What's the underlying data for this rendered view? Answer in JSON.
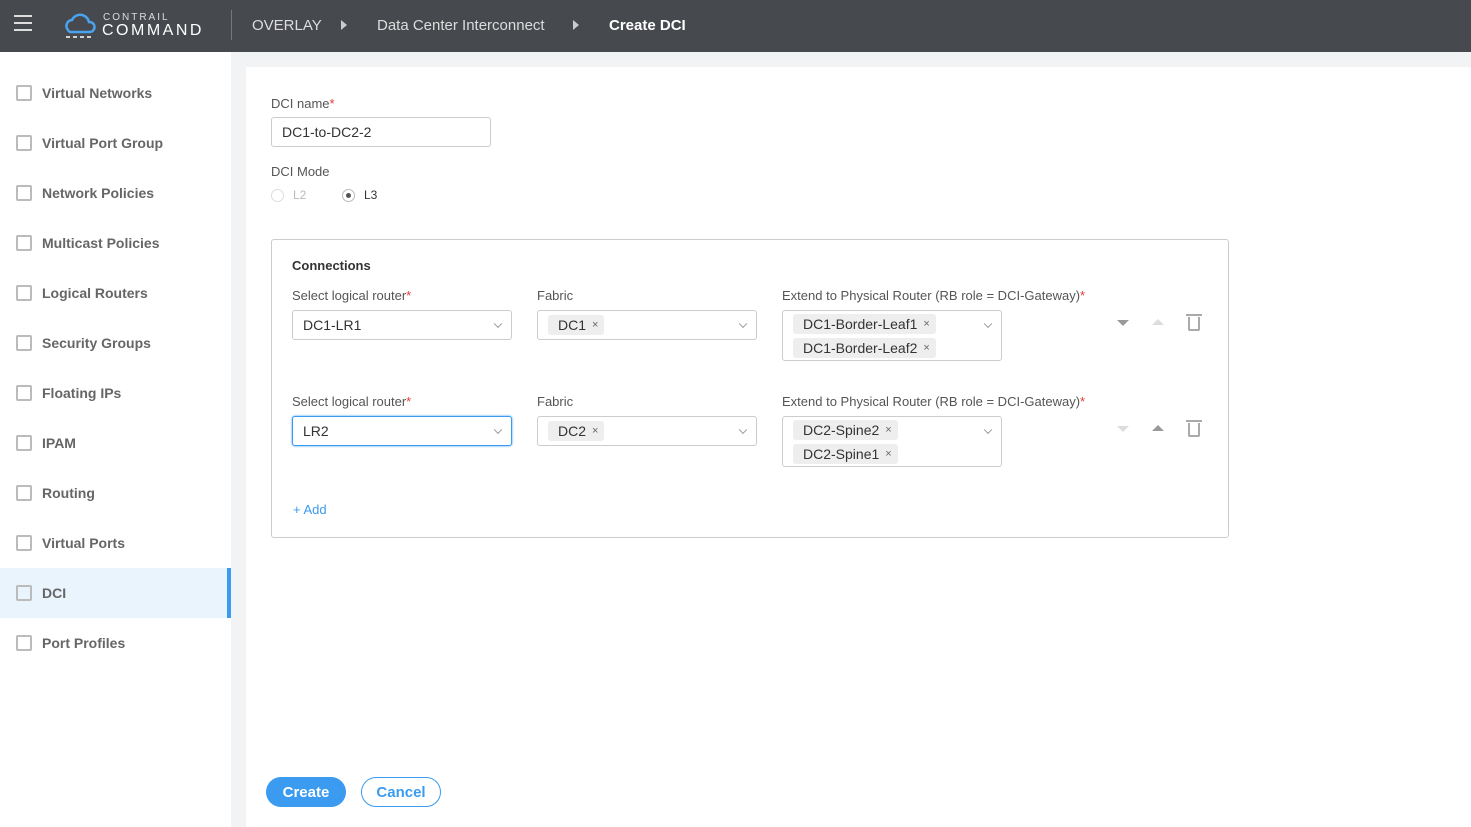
{
  "header": {
    "logo_top": "CONTRAIL",
    "logo_bottom": "COMMAND",
    "breadcrumb": [
      "OVERLAY",
      "Data Center Interconnect",
      "Create DCI"
    ]
  },
  "sidebar": {
    "items": [
      {
        "label": "Virtual Networks",
        "icon": "virtual-networks-icon"
      },
      {
        "label": "Virtual Port Group",
        "icon": "port-group-icon"
      },
      {
        "label": "Network Policies",
        "icon": "policy-icon"
      },
      {
        "label": "Multicast Policies",
        "icon": "multicast-icon"
      },
      {
        "label": "Logical Routers",
        "icon": "router-icon"
      },
      {
        "label": "Security Groups",
        "icon": "security-icon"
      },
      {
        "label": "Floating IPs",
        "icon": "floating-ip-icon"
      },
      {
        "label": "IPAM",
        "icon": "ipam-icon"
      },
      {
        "label": "Routing",
        "icon": "routing-icon"
      },
      {
        "label": "Virtual Ports",
        "icon": "port-icon"
      },
      {
        "label": "DCI",
        "icon": "dci-icon",
        "active": true
      },
      {
        "label": "Port Profiles",
        "icon": "profile-icon"
      }
    ]
  },
  "form": {
    "name_label": "DCI name",
    "name_value": "DC1-to-DC2-2",
    "mode_label": "DCI Mode",
    "modes": [
      "L2",
      "L3"
    ],
    "selected_mode": "L3",
    "connections_title": "Connections",
    "lr_label": "Select logical router",
    "fabric_label": "Fabric",
    "pr_label": "Extend to Physical Router (RB role = DCI-Gateway)",
    "rows": [
      {
        "router": "DC1-LR1",
        "fabric": "DC1",
        "routers": [
          "DC1-Border-Leaf1",
          "DC1-Border-Leaf2"
        ]
      },
      {
        "router": "LR2",
        "fabric": "DC2",
        "routers": [
          "DC2-Spine2",
          "DC2-Spine1"
        ]
      }
    ],
    "add_label": "+ Add",
    "create_label": "Create",
    "cancel_label": "Cancel"
  },
  "colors": {
    "header": "#46494e",
    "accent": "#3a9bf0"
  }
}
